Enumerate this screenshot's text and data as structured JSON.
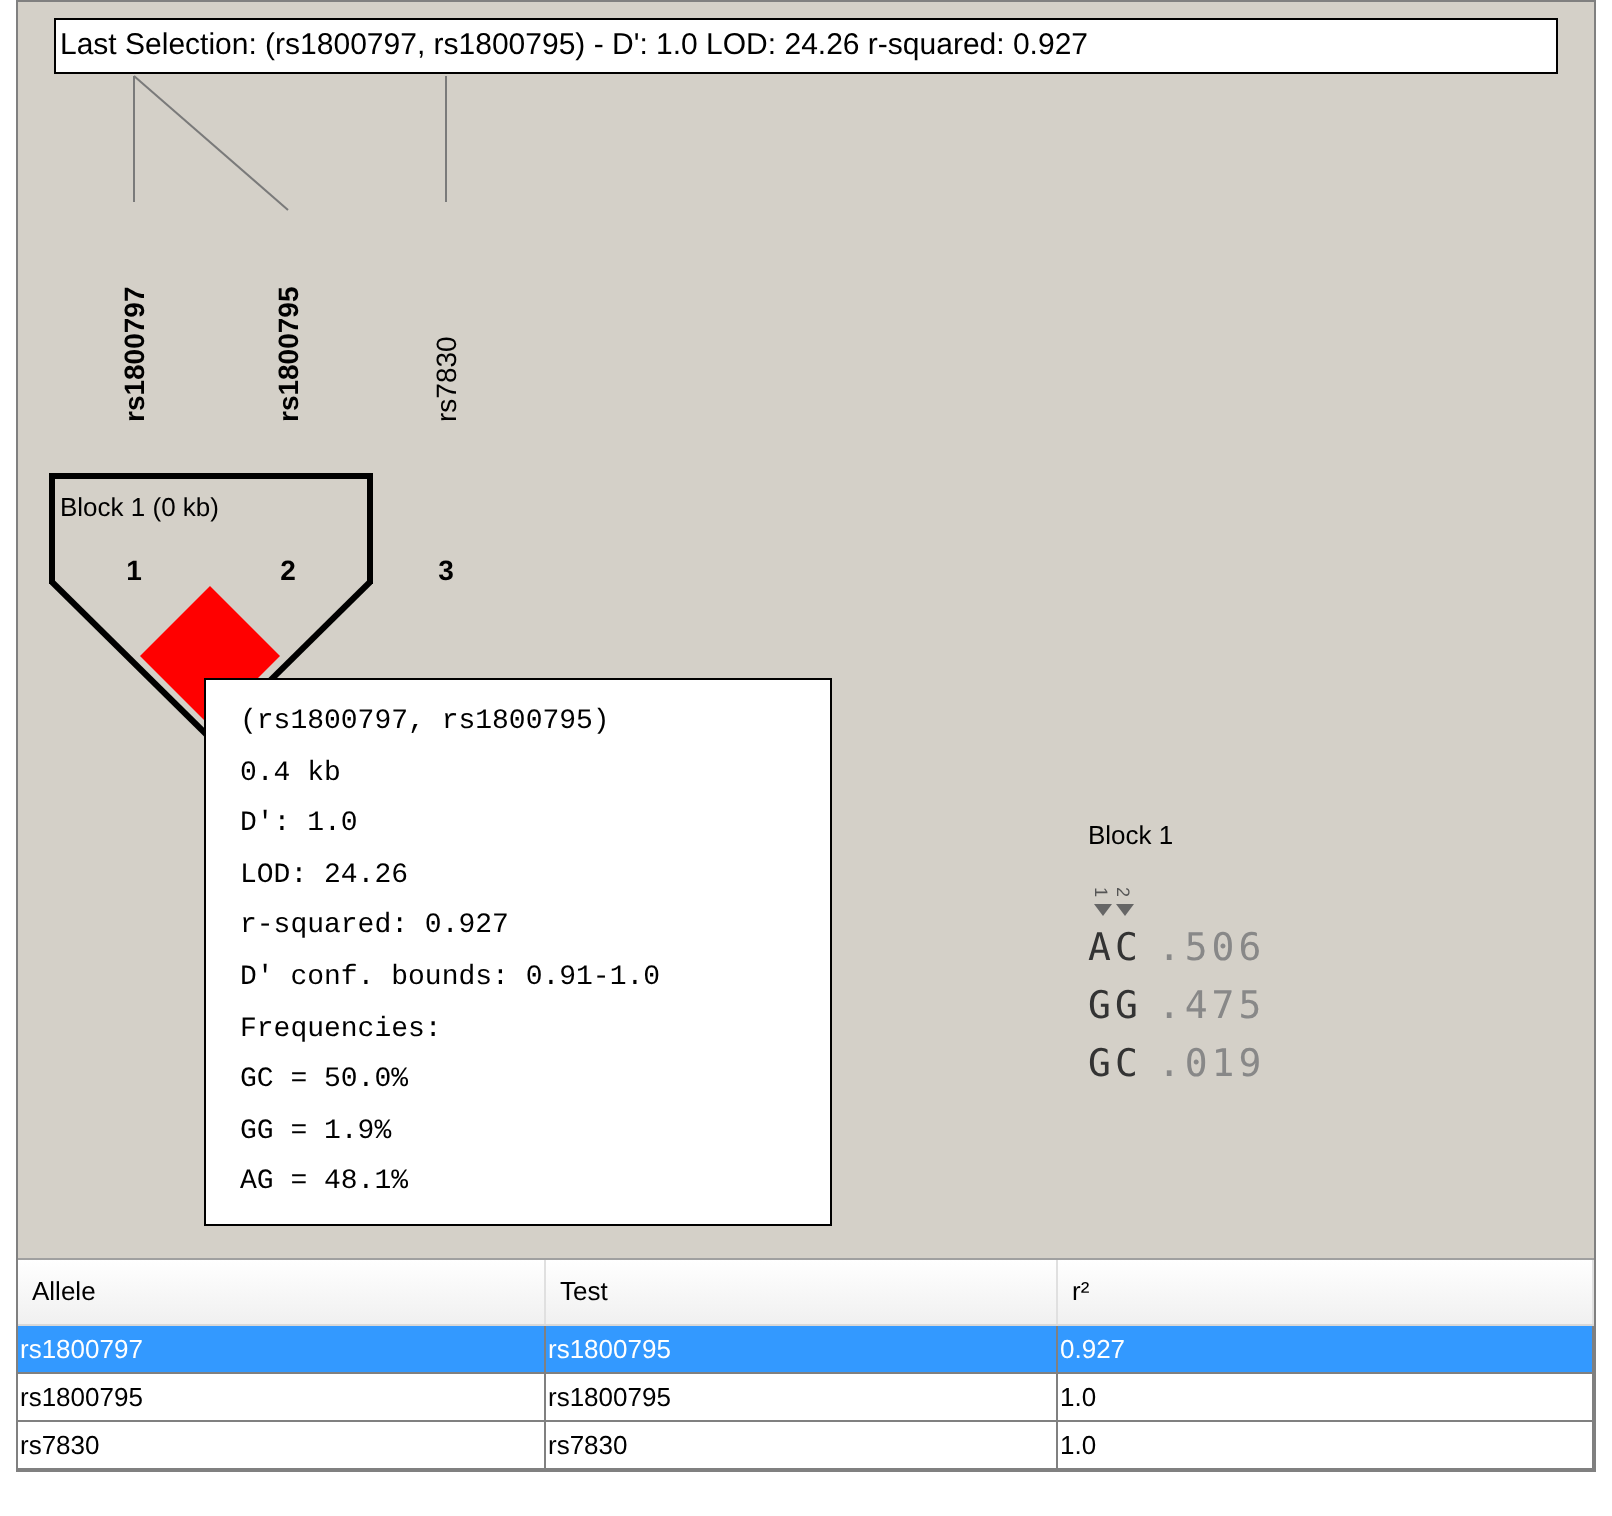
{
  "selection": {
    "text": "Last Selection: (rs1800797, rs1800795) -  D': 1.0  LOD: 24.26  r-squared: 0.927"
  },
  "markers": [
    {
      "name": "rs1800797",
      "number": "1",
      "selected": true
    },
    {
      "name": "rs1800795",
      "number": "2",
      "selected": true
    },
    {
      "name": "rs7830",
      "number": "3",
      "selected": false
    }
  ],
  "block": {
    "label": "Block 1 (0 kb)"
  },
  "ld_cells": [
    {
      "color": "#ff0000"
    }
  ],
  "tooltip": {
    "lines": [
      "(rs1800797, rs1800795)",
      "0.4 kb",
      "D': 1.0",
      "LOD: 24.26",
      "r-squared: 0.927",
      "D' conf. bounds: 0.91-1.0",
      "Frequencies:",
      "GC = 50.0%",
      "GG = 1.9%",
      "AG = 48.1%"
    ]
  },
  "haplotypes": {
    "title": "Block 1",
    "marker_numbers": [
      "1",
      "2"
    ],
    "rows": [
      {
        "alleles": "AC",
        "frequency": ".506"
      },
      {
        "alleles": "GG",
        "frequency": ".475"
      },
      {
        "alleles": "GC",
        "frequency": ".019"
      }
    ]
  },
  "table": {
    "columns": [
      "Allele",
      "Test",
      "r²"
    ],
    "rows": [
      {
        "cells": [
          "rs1800797",
          "rs1800795",
          "0.927"
        ],
        "selected": true
      },
      {
        "cells": [
          "rs1800795",
          "rs1800795",
          "1.0"
        ],
        "selected": false
      },
      {
        "cells": [
          "rs7830",
          "rs7830",
          "1.0"
        ],
        "selected": false
      }
    ]
  }
}
